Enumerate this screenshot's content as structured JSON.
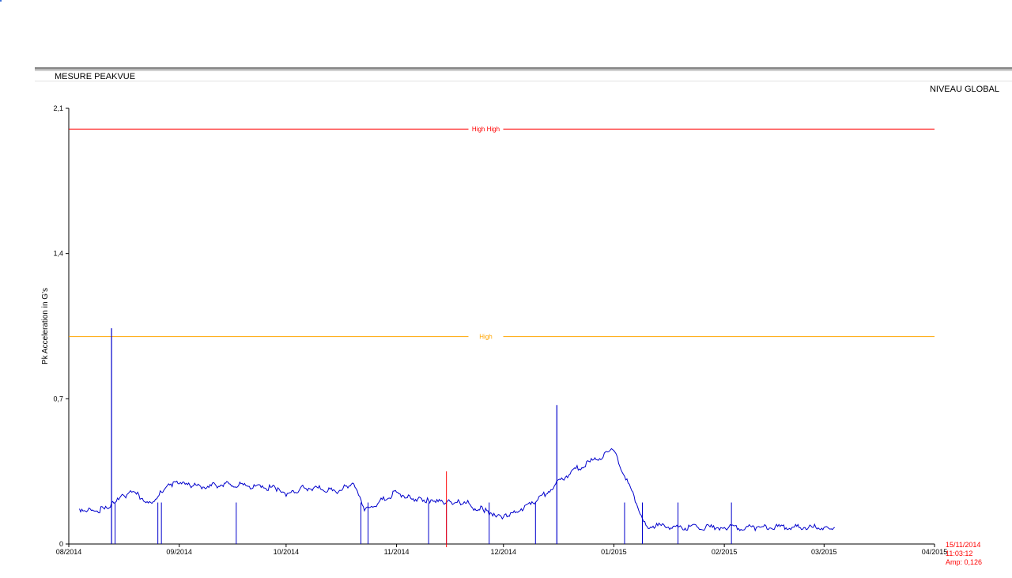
{
  "window": {
    "panel_title": "MESURE PEAKVUE"
  },
  "chart_data": {
    "type": "line",
    "title": "NIVEAU GLOBAL",
    "xlabel": "",
    "ylabel": "Pk Acceleration in G's",
    "ylim": [
      0,
      2.1
    ],
    "y_ticks": [
      "0",
      "0,7",
      "1,4",
      "2,1"
    ],
    "xlim": [
      "2014-08-01",
      "2015-04-01"
    ],
    "x_ticks": [
      "08/2014",
      "09/2014",
      "10/2014",
      "11/2014",
      "12/2014",
      "01/2015",
      "02/2015",
      "03/2015",
      "04/2015"
    ],
    "thresholds": [
      {
        "name": "High High",
        "value": 2.0,
        "color": "#ff0000"
      },
      {
        "name": "High",
        "value": 1.0,
        "color": "#ffa500"
      }
    ],
    "series": [
      {
        "color": "#0000cc",
        "x": [
          "2014-08-04",
          "2014-08-08",
          "2014-08-12",
          "2014-08-14",
          "2014-08-18",
          "2014-08-20",
          "2014-08-24",
          "2014-08-27",
          "2014-08-29",
          "2014-09-01",
          "2014-09-05",
          "2014-09-10",
          "2014-09-15",
          "2014-09-20",
          "2014-09-25",
          "2014-09-28",
          "2014-10-01",
          "2014-10-05",
          "2014-10-10",
          "2014-10-15",
          "2014-10-18",
          "2014-10-20",
          "2014-10-23",
          "2014-10-27",
          "2014-11-01",
          "2014-11-05",
          "2014-11-08",
          "2014-11-10",
          "2014-11-12",
          "2014-11-15",
          "2014-11-18",
          "2014-11-21",
          "2014-11-23",
          "2014-11-25",
          "2014-11-27",
          "2014-11-29",
          "2014-12-01",
          "2014-12-03",
          "2014-12-04",
          "2014-12-06",
          "2014-12-10",
          "2014-12-20",
          "2015-01-01",
          "2015-01-10",
          "2015-01-20",
          "2015-02-01",
          "2015-02-10",
          "2015-02-20",
          "2015-03-01",
          "2015-03-04"
        ],
        "y": [
          0.17,
          0.16,
          0.17,
          0.2,
          0.25,
          0.24,
          0.2,
          0.25,
          0.29,
          0.29,
          0.28,
          0.28,
          0.29,
          0.28,
          0.27,
          0.27,
          0.23,
          0.27,
          0.27,
          0.25,
          0.28,
          0.29,
          0.16,
          0.2,
          0.25,
          0.22,
          0.22,
          0.21,
          0.2,
          0.2,
          0.2,
          0.21,
          0.17,
          0.18,
          0.14,
          0.13,
          0.13,
          0.15,
          0.16,
          0.17,
          0.2,
          0.35,
          0.45,
          0.09,
          0.08,
          0.08,
          0.08,
          0.08,
          0.08,
          0.08
        ]
      }
    ],
    "spikes": [
      {
        "x": "2014-08-13",
        "y": 1.04
      },
      {
        "x": "2014-12-16",
        "y": 0.67
      }
    ],
    "cursor": {
      "x": "2014-11-15",
      "color": "#ff0000"
    }
  },
  "cursor_readout": {
    "date": "15/11/2014",
    "time": "11:03:12",
    "amp": "Amp: 0,126"
  }
}
